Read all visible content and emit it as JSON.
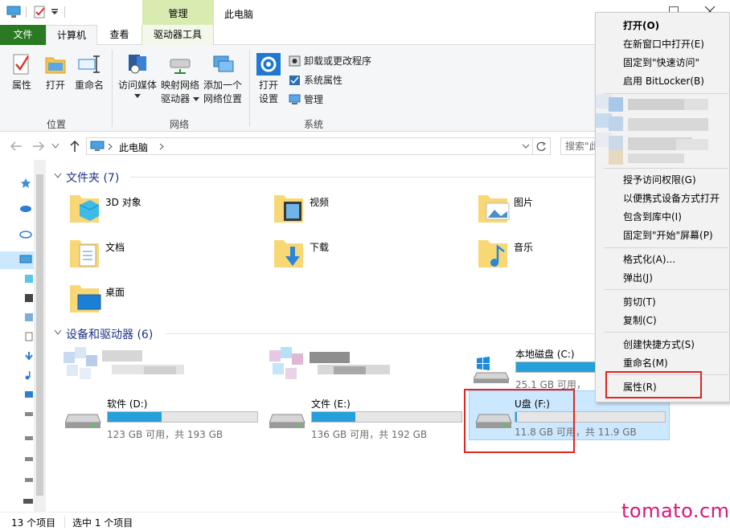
{
  "window": {
    "title": "此电脑",
    "context_tab": "管理"
  },
  "ribbon_tabs": {
    "file": "文件",
    "computer": "计算机",
    "view": "查看",
    "drive_tools": "驱动器工具"
  },
  "ribbon": {
    "location": {
      "properties": "属性",
      "open": "打开",
      "rename": "重命名",
      "group": "位置"
    },
    "network": {
      "media_line1": "访问媒体",
      "map_line1": "映射网络",
      "map_line2": "驱动器",
      "add_line1": "添加一个",
      "add_line2": "网络位置",
      "group": "网络"
    },
    "system": {
      "settings_line1": "打开",
      "settings_line2": "设置",
      "uninstall": "卸载或更改程序",
      "sysprops": "系统属性",
      "manage": "管理",
      "group": "系统"
    }
  },
  "address": {
    "path": "此电脑",
    "search_placeholder": "搜索\"此"
  },
  "sections": {
    "folders": "文件夹 (7)",
    "drives": "设备和驱动器 (6)"
  },
  "folders": [
    {
      "name": "3D 对象"
    },
    {
      "name": "视频"
    },
    {
      "name": "图片"
    },
    {
      "name": "文档"
    },
    {
      "name": "下载"
    },
    {
      "name": "音乐"
    },
    {
      "name": "桌面"
    }
  ],
  "drives": [
    {
      "name": "本地磁盘 (C:)",
      "size": "25.1 GB 可用，",
      "used_fraction": 0.75
    },
    {
      "name": "软件 (D:)",
      "size": "123 GB 可用，共 193 GB",
      "used_fraction": 0.36
    },
    {
      "name": "文件 (E:)",
      "size": "136 GB 可用，共 192 GB",
      "used_fraction": 0.29
    },
    {
      "name": "U盘 (F:)",
      "size": "11.8 GB 可用，共 11.9 GB",
      "used_fraction": 0.01
    }
  ],
  "status": {
    "count": "13 个项目",
    "selected": "选中 1 个项目"
  },
  "context_menu": [
    "打开(O)",
    "在新窗口中打开(E)",
    "固定到\"快速访问\"",
    "启用 BitLocker(B)",
    "授予访问权限(G)",
    "以便携式设备方式打开",
    "包含到库中(I)",
    "固定到\"开始\"屏幕(P)",
    "格式化(A)...",
    "弹出(J)",
    "剪切(T)",
    "复制(C)",
    "创建快捷方式(S)",
    "重命名(M)",
    "属性(R)"
  ],
  "watermark": "tomato.cm",
  "colors": {
    "accent": "#26a0da",
    "highlight": "#e3241f",
    "file_tab": "#2b7a23",
    "watermark": "#d6197d"
  }
}
